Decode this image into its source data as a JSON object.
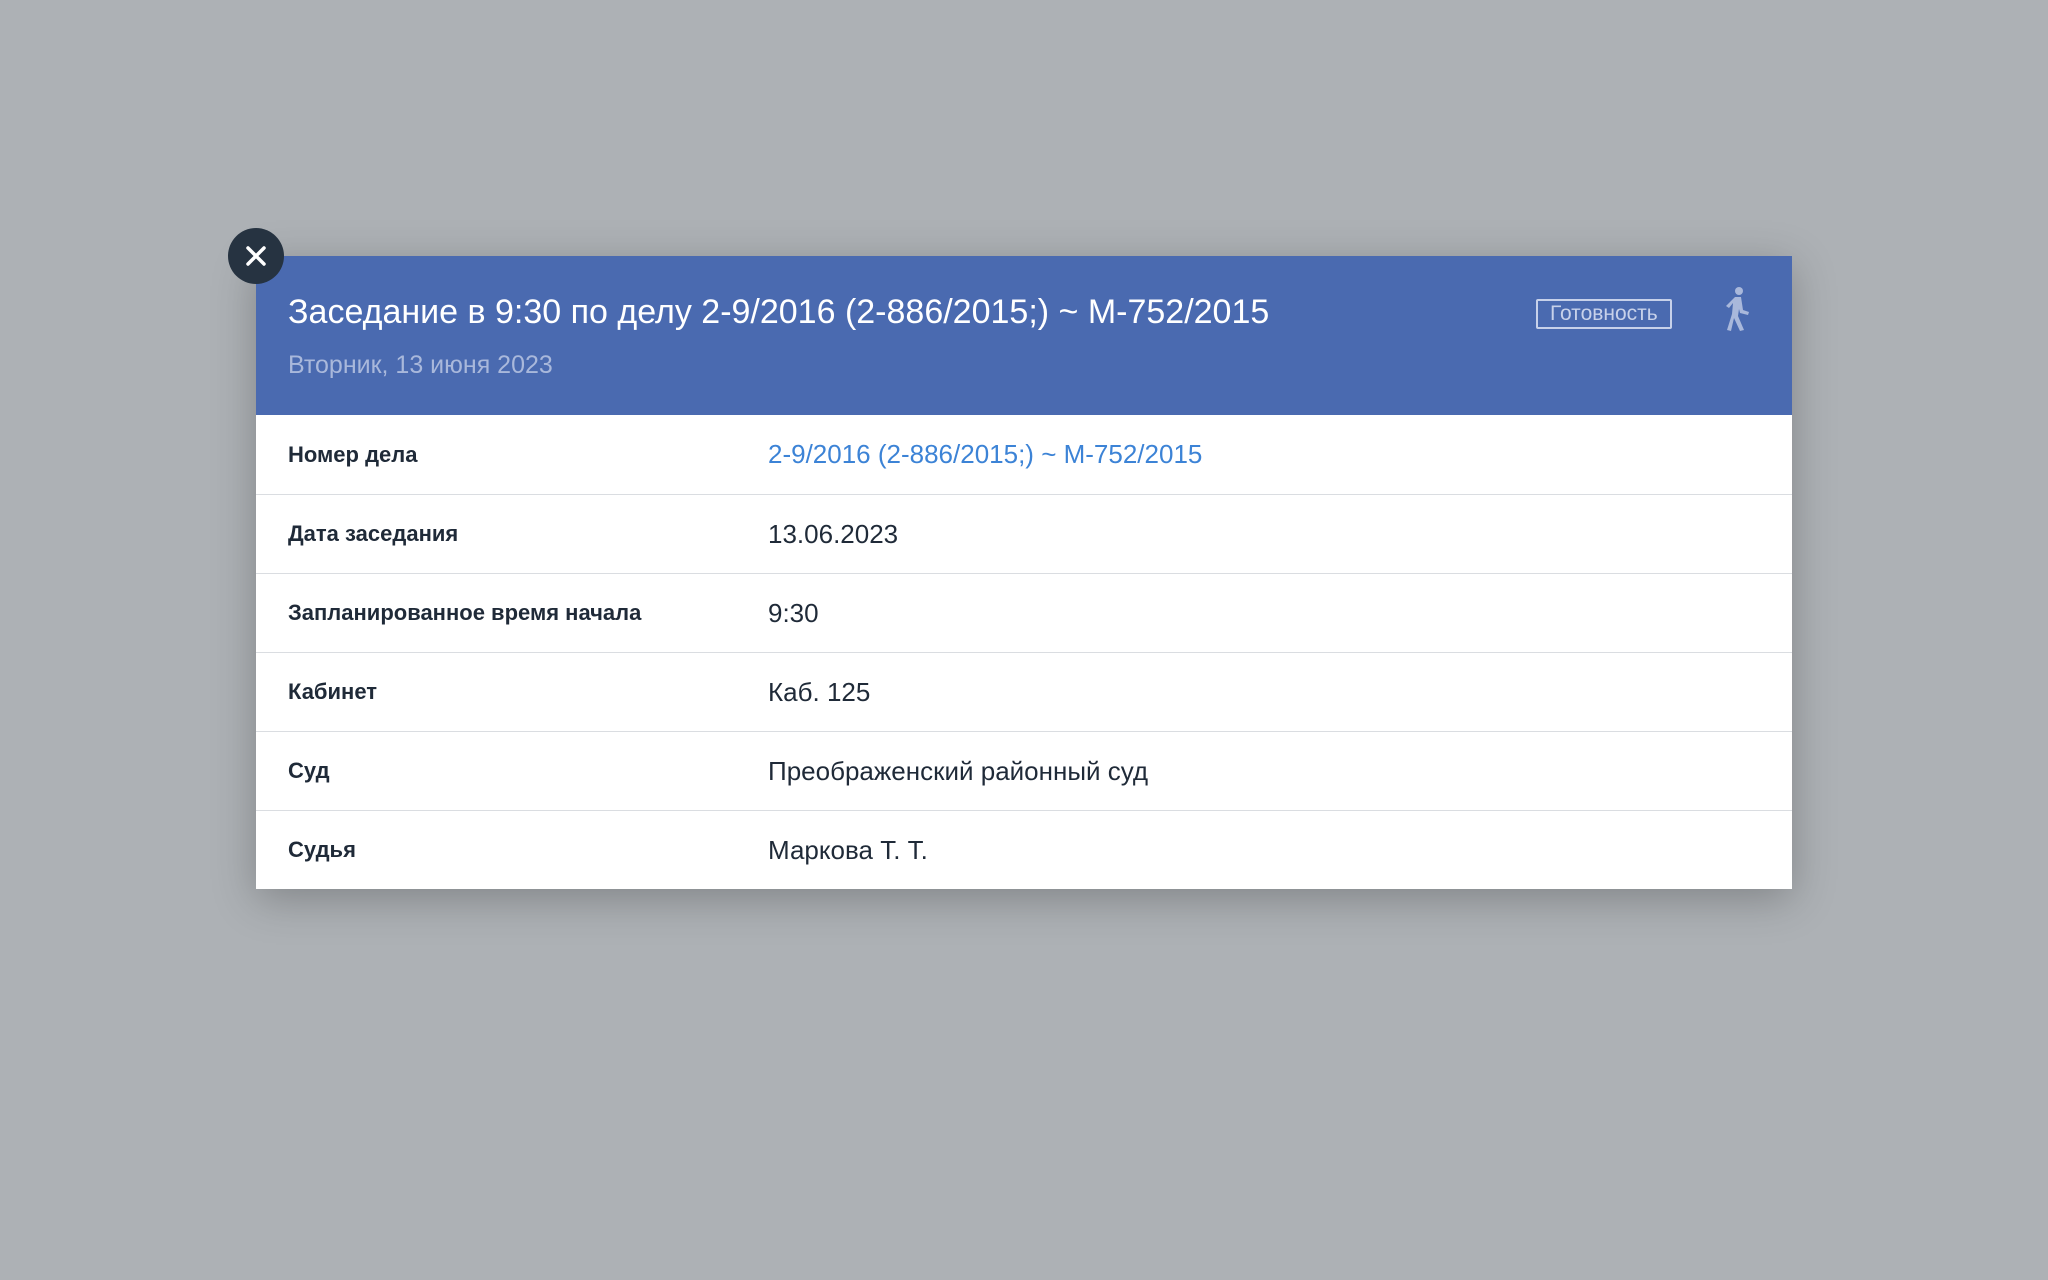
{
  "modal": {
    "title": "Заседание в 9:30 по делу 2-9/2016 (2-886/2015;) ~ М-752/2015",
    "subtitle": "Вторник, 13 июня 2023",
    "status_badge": "Готовность",
    "close_icon": "close-icon",
    "walk_icon": "walking-person-icon"
  },
  "details": [
    {
      "label": "Номер дела",
      "value": "2-9/2016 (2-886/2015;) ~ М-752/2015",
      "is_link": true
    },
    {
      "label": "Дата заседания",
      "value": "13.06.2023",
      "is_link": false
    },
    {
      "label": "Запланированное время начала",
      "value": "9:30",
      "is_link": false
    },
    {
      "label": "Кабинет",
      "value": "Каб. 125",
      "is_link": false
    },
    {
      "label": "Суд",
      "value": "Преображенский районный суд",
      "is_link": false
    },
    {
      "label": "Судья",
      "value": "Маркова Т. Т.",
      "is_link": false
    }
  ],
  "colors": {
    "backdrop": "#adb1b5",
    "header": "#4a6ab0",
    "link": "#3c83d6",
    "close_button": "#263341"
  }
}
